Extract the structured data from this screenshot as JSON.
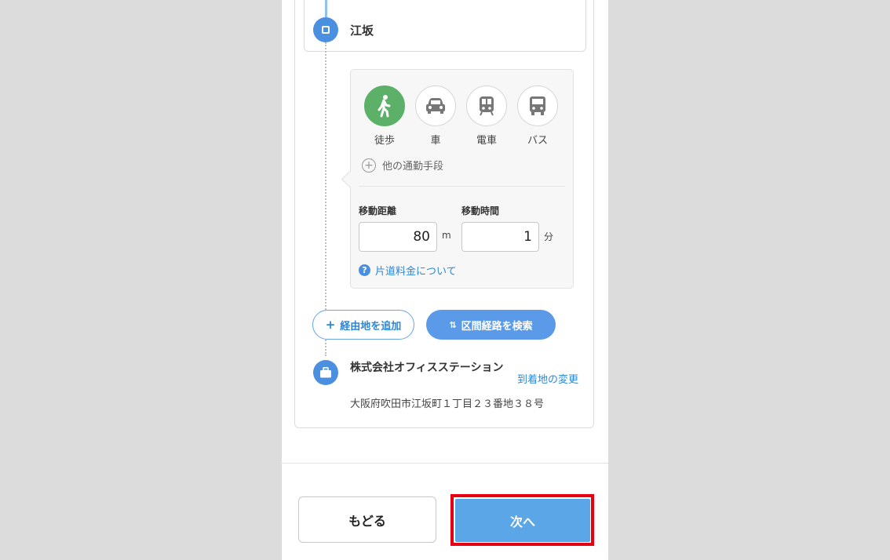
{
  "origin": {
    "name": "江坂",
    "icon": "stop-square-icon"
  },
  "transport": {
    "modes": [
      {
        "label": "徒歩",
        "icon": "walk-icon",
        "active": true
      },
      {
        "label": "車",
        "icon": "car-icon",
        "active": false
      },
      {
        "label": "電車",
        "icon": "train-icon",
        "active": false
      },
      {
        "label": "バス",
        "icon": "bus-icon",
        "active": false
      }
    ],
    "other_modes": "他の通勤手段",
    "distance": {
      "label": "移動距離",
      "value": "80",
      "unit": "m"
    },
    "time": {
      "label": "移動時間",
      "value": "1",
      "unit": "分"
    },
    "help_link": "片道料金について"
  },
  "actions": {
    "add_waypoint": "経由地を追加",
    "search_route": "区間経路を検索"
  },
  "destination": {
    "name": "株式会社オフィスステーション",
    "address": "大阪府吹田市江坂町１丁目２３番地３８号",
    "change_link": "到着地の変更",
    "icon": "briefcase-icon"
  },
  "footer": {
    "back": "もどる",
    "next": "次へ"
  },
  "colors": {
    "accent": "#5a9ae8",
    "walk_active": "#5cb068",
    "highlight": "#e60012"
  }
}
